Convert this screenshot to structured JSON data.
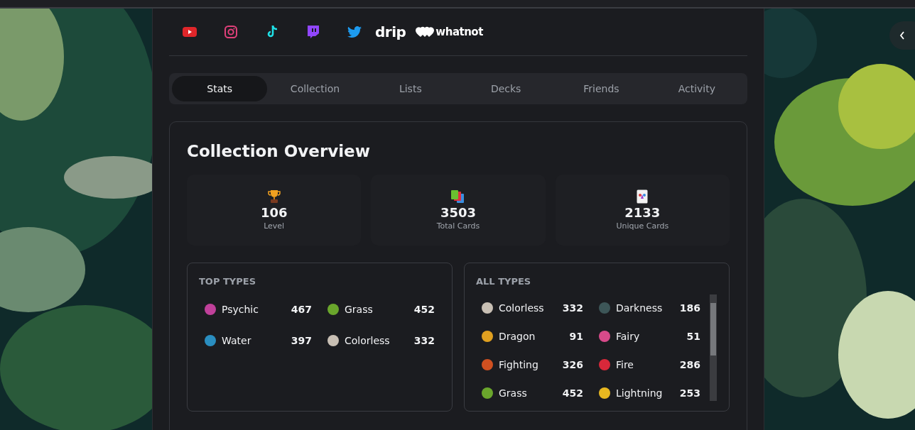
{
  "socials": [
    {
      "kind": "youtube"
    },
    {
      "kind": "instagram"
    },
    {
      "kind": "tiktok"
    },
    {
      "kind": "twitch"
    },
    {
      "kind": "twitter"
    },
    {
      "kind": "drip",
      "label": "drip"
    },
    {
      "kind": "whatnot",
      "label": "whatnot"
    }
  ],
  "tabs": [
    {
      "label": "Stats",
      "selected": true
    },
    {
      "label": "Collection",
      "selected": false
    },
    {
      "label": "Lists",
      "selected": false
    },
    {
      "label": "Decks",
      "selected": false
    },
    {
      "label": "Friends",
      "selected": false
    },
    {
      "label": "Activity",
      "selected": false
    }
  ],
  "overview": {
    "title": "Collection Overview",
    "stats": [
      {
        "kind": "trophy",
        "value": "106",
        "label": "Level"
      },
      {
        "kind": "cards",
        "value": "3503",
        "label": "Total Cards"
      },
      {
        "kind": "card",
        "value": "2133",
        "label": "Unique Cards"
      }
    ]
  },
  "top_types": {
    "title": "TOP TYPES",
    "items": [
      {
        "name": "Psychic",
        "count": "467",
        "color": "#c0409a"
      },
      {
        "name": "Grass",
        "count": "452",
        "color": "#6aa62c"
      },
      {
        "name": "Water",
        "count": "397",
        "color": "#2a8ec0"
      },
      {
        "name": "Colorless",
        "count": "332",
        "color": "#c8bfb4"
      }
    ]
  },
  "all_types": {
    "title": "ALL TYPES",
    "items": [
      {
        "name": "Colorless",
        "count": "332",
        "color": "#c8bfb4"
      },
      {
        "name": "Darkness",
        "count": "186",
        "color": "#3d5658"
      },
      {
        "name": "Dragon",
        "count": "91",
        "color": "#e0a020"
      },
      {
        "name": "Fairy",
        "count": "51",
        "color": "#d84a8a"
      },
      {
        "name": "Fighting",
        "count": "326",
        "color": "#d05020"
      },
      {
        "name": "Fire",
        "count": "286",
        "color": "#d8283a"
      },
      {
        "name": "Grass",
        "count": "452",
        "color": "#6aa62c"
      },
      {
        "name": "Lightning",
        "count": "253",
        "color": "#e8b820"
      }
    ]
  }
}
